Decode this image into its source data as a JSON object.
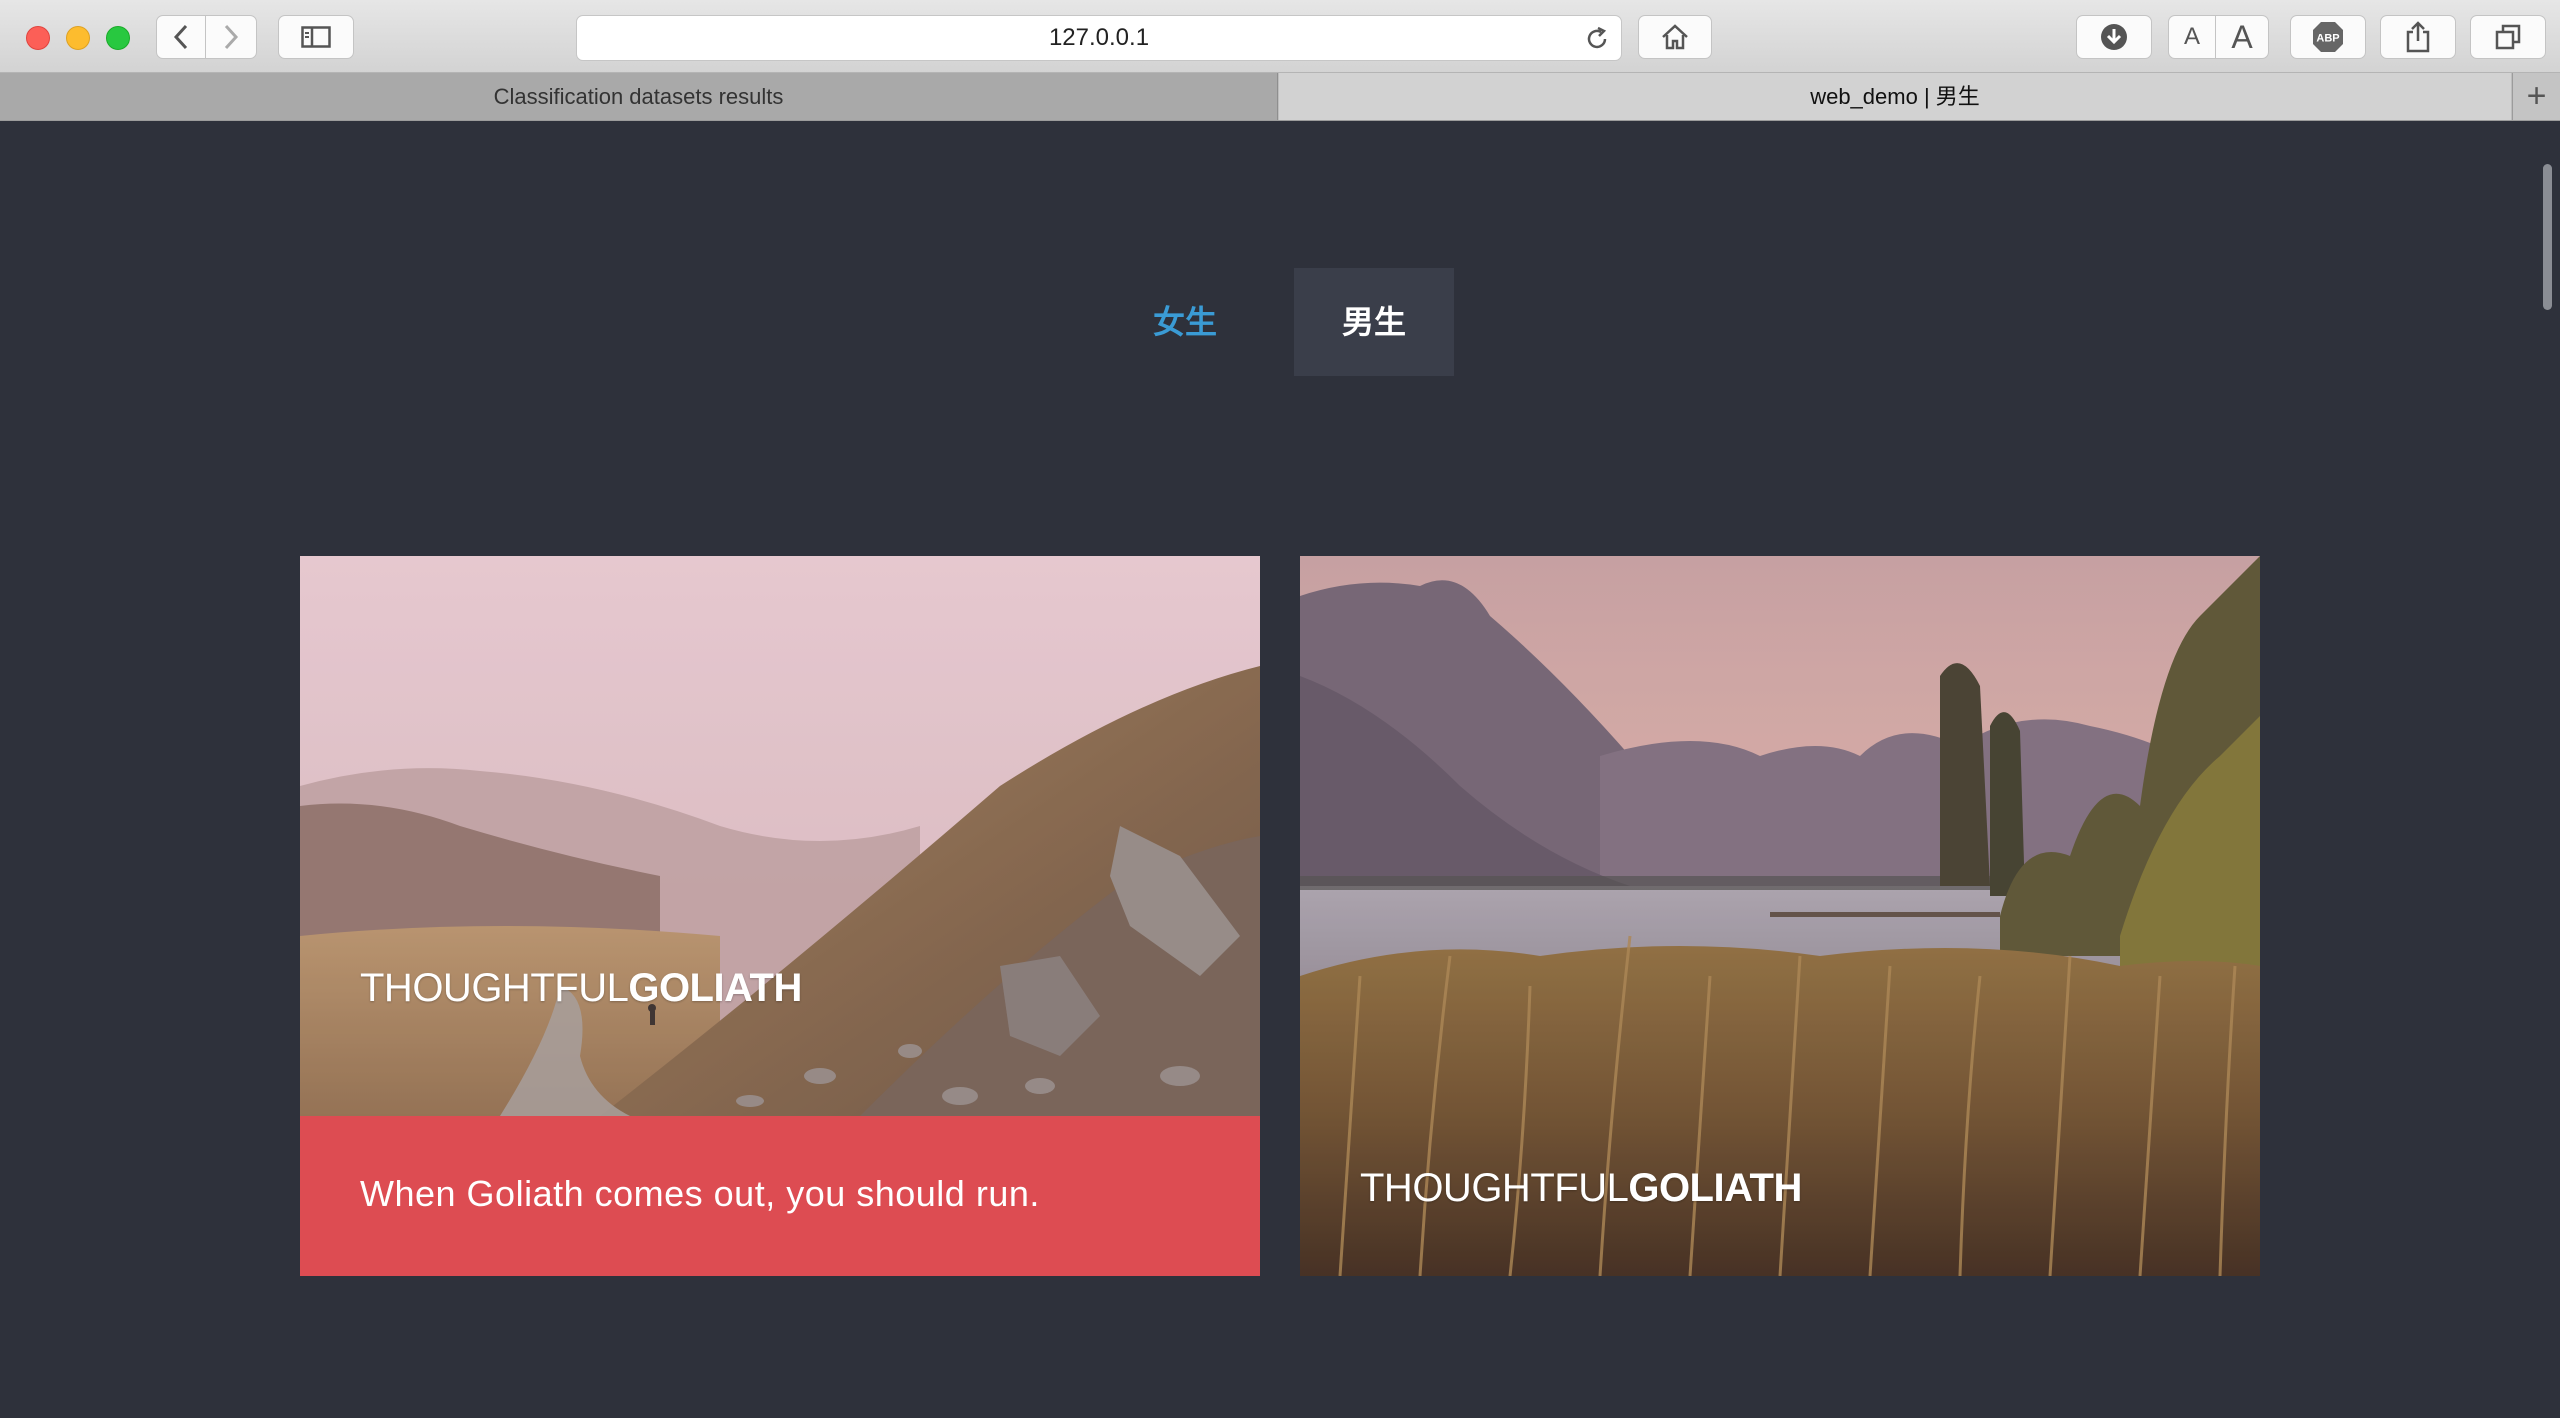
{
  "browser": {
    "url": "127.0.0.1",
    "tabs": [
      {
        "label": "Classification datasets results",
        "active": false
      },
      {
        "label": "web_demo | 男生",
        "active": true
      }
    ],
    "add_tab_label": "+",
    "text_size_small": "A",
    "text_size_large": "A",
    "adblock_label": "ABP"
  },
  "page": {
    "nav": [
      {
        "label": "女生",
        "color": "#3a9bd5"
      },
      {
        "label": "男生",
        "selected": true
      }
    ],
    "cards": [
      {
        "title_light": "THOUGHTFUL",
        "title_bold": "GOLIATH",
        "caption": "When Goliath comes out, you should run.",
        "image": "mountain-trail-photo",
        "caption_color": "#dd4c52"
      },
      {
        "title_light": "THOUGHTFUL",
        "title_bold": "GOLIATH",
        "image": "lake-reeds-photo"
      }
    ]
  },
  "colors": {
    "page_background": "#2e313b",
    "accent_blue": "#3a9bd5",
    "selected_tab_background": "#3a3e4a"
  }
}
